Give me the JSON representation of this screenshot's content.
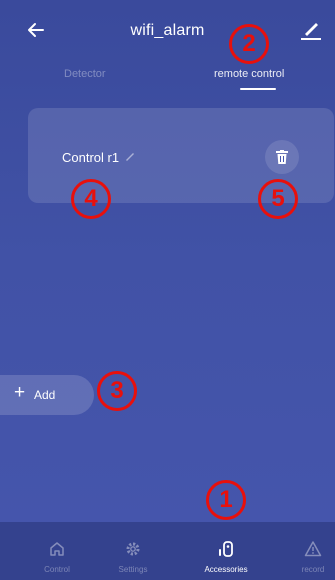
{
  "header": {
    "title": "wifi_alarm",
    "back_icon": "back-arrow-icon",
    "edit_icon": "edit-pencil-icon"
  },
  "tabs": [
    {
      "label": "Detector",
      "active": false
    },
    {
      "label": "remote control",
      "active": true
    }
  ],
  "devices": [
    {
      "name": "Control r1",
      "edit_icon": "pencil-icon",
      "delete_icon": "trash-icon"
    }
  ],
  "add_button": {
    "label": "Add",
    "icon": "plus-icon"
  },
  "bottom_nav": [
    {
      "label": "Control",
      "icon": "home-icon",
      "active": false
    },
    {
      "label": "Settings",
      "icon": "gear-icon",
      "active": false
    },
    {
      "label": "Accessories",
      "icon": "remote-icon",
      "active": true
    },
    {
      "label": "record",
      "icon": "warning-triangle-icon",
      "active": false
    }
  ],
  "annotations": [
    "1",
    "2",
    "3",
    "4",
    "5"
  ],
  "colors": {
    "background": "#3f4fa2",
    "nav_background": "#34428e",
    "annotation": "#e8100c"
  }
}
